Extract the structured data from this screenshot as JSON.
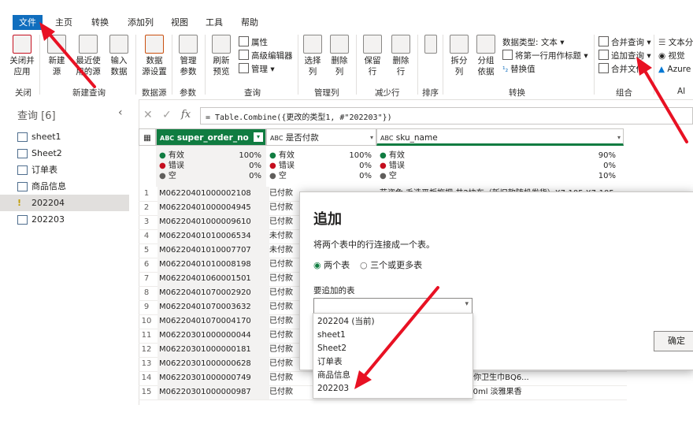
{
  "menu": {
    "file": "文件",
    "home": "主页",
    "transform": "转换",
    "add_column": "添加列",
    "view": "视图",
    "tools": "工具",
    "help": "帮助"
  },
  "ribbon": {
    "close_apply_1": "关闭并",
    "close_apply_2": "应用",
    "new_source_1": "新建",
    "new_source_2": "源",
    "recent_1": "最近使",
    "recent_2": "用的源",
    "enter_data_1": "输入",
    "enter_data_2": "数据",
    "ds_settings_1": "数据",
    "ds_settings_2": "源设置",
    "manage_params_1": "管理",
    "manage_params_2": "参数",
    "refresh_1": "刷新",
    "refresh_2": "预览",
    "properties": "属性",
    "adv_editor": "高级编辑器",
    "manage": "管理",
    "choose_cols_1": "选择",
    "choose_cols_2": "列",
    "remove_cols_1": "删除",
    "remove_cols_2": "列",
    "keep_rows_1": "保留",
    "keep_rows_2": "行",
    "remove_rows_1": "删除",
    "remove_rows_2": "行",
    "split_1": "拆分",
    "split_2": "列",
    "group_1": "分组",
    "group_2": "依据",
    "data_type": "数据类型: 文本",
    "first_row_header": "将第一行用作标题",
    "replace_values": "替换值",
    "merge_queries": "合并查询",
    "append_queries": "追加查询",
    "combine_files": "合并文件",
    "text_analytics": "文本分",
    "vision": "视觉",
    "azure": "Azure",
    "groups": {
      "close": "关闭",
      "new_query": "新建查询",
      "data_sources": "数据源",
      "parameters": "参数",
      "query": "查询",
      "manage_cols": "管理列",
      "reduce_rows": "减少行",
      "sort": "排序",
      "transform": "转换",
      "combine": "组合",
      "ai": "AI"
    }
  },
  "queries": {
    "header": "查询 [6]",
    "items": [
      "sheet1",
      "Sheet2",
      "订单表",
      "商品信息",
      "202204",
      "202203"
    ]
  },
  "formula": "= Table.Combine({更改的类型1, #\"202203\"})",
  "columns": {
    "c1": "super_order_no",
    "c2": "是否付款",
    "c3": "sku_name",
    "type_icon": "ABC"
  },
  "profile": {
    "valid": "有效",
    "error": "错误",
    "empty": "空",
    "c1": [
      "100%",
      "0%",
      "0%"
    ],
    "c2": [
      "100%",
      "0%",
      "0%"
    ],
    "c3": [
      "90%",
      "0%",
      "10%"
    ]
  },
  "rows": [
    {
      "n": "1",
      "a": "M06220401000002108",
      "b": "已付款",
      "c": "艺姿兔 毛选平板拖把 井2块布（新旧款随机发货）X7-105 X7-105"
    },
    {
      "n": "2",
      "a": "M06220401000004945",
      "b": "已付款",
      "c": ""
    },
    {
      "n": "3",
      "a": "M06220401000009610",
      "b": "已付款",
      "c": ""
    },
    {
      "n": "4",
      "a": "M06220401010006534",
      "b": "未付款",
      "c": ""
    },
    {
      "n": "5",
      "a": "M06220401010007707",
      "b": "未付款",
      "c": ""
    },
    {
      "n": "6",
      "a": "M06220401010008198",
      "b": "已付款",
      "c": ""
    },
    {
      "n": "7",
      "a": "M06220401060001501",
      "b": "已付款",
      "c": ""
    },
    {
      "n": "8",
      "a": "M06220401070002920",
      "b": "已付款",
      "c": ""
    },
    {
      "n": "9",
      "a": "M06220401070003632",
      "b": "已付款",
      "c": ""
    },
    {
      "n": "10",
      "a": "M06220401070004170",
      "b": "已付款",
      "c": ""
    },
    {
      "n": "11",
      "a": "M06220301000000044",
      "b": "已付款",
      "c": ""
    },
    {
      "n": "12",
      "a": "M06220301000000181",
      "b": "已付款",
      "c": ""
    },
    {
      "n": "13",
      "a": "M06220301000000628",
      "b": "已付款",
      "c": ""
    },
    {
      "n": "14",
      "a": "M06220301000000749",
      "b": "已付款",
      "c": "高卫生巾女18片6盒透气迷你卫生巾BQ6..."
    },
    {
      "n": "15",
      "a": "M06220301000000987",
      "b": "已付款",
      "c": "...香 持久精油 活力都市100ml 淡雅果香"
    }
  ],
  "dialog": {
    "title": "追加",
    "desc": "将两个表中的行连接成一个表。",
    "opt_two": "两个表",
    "opt_three": "三个或更多表",
    "table_label": "要追加的表",
    "ok": "确定",
    "options": [
      "202204 (当前)",
      "sheet1",
      "Sheet2",
      "订单表",
      "商品信息",
      "202203"
    ]
  },
  "colors": {
    "file_blue": "#106ebe",
    "accent_green": "#107c41",
    "arrow_red": "#e81123"
  }
}
